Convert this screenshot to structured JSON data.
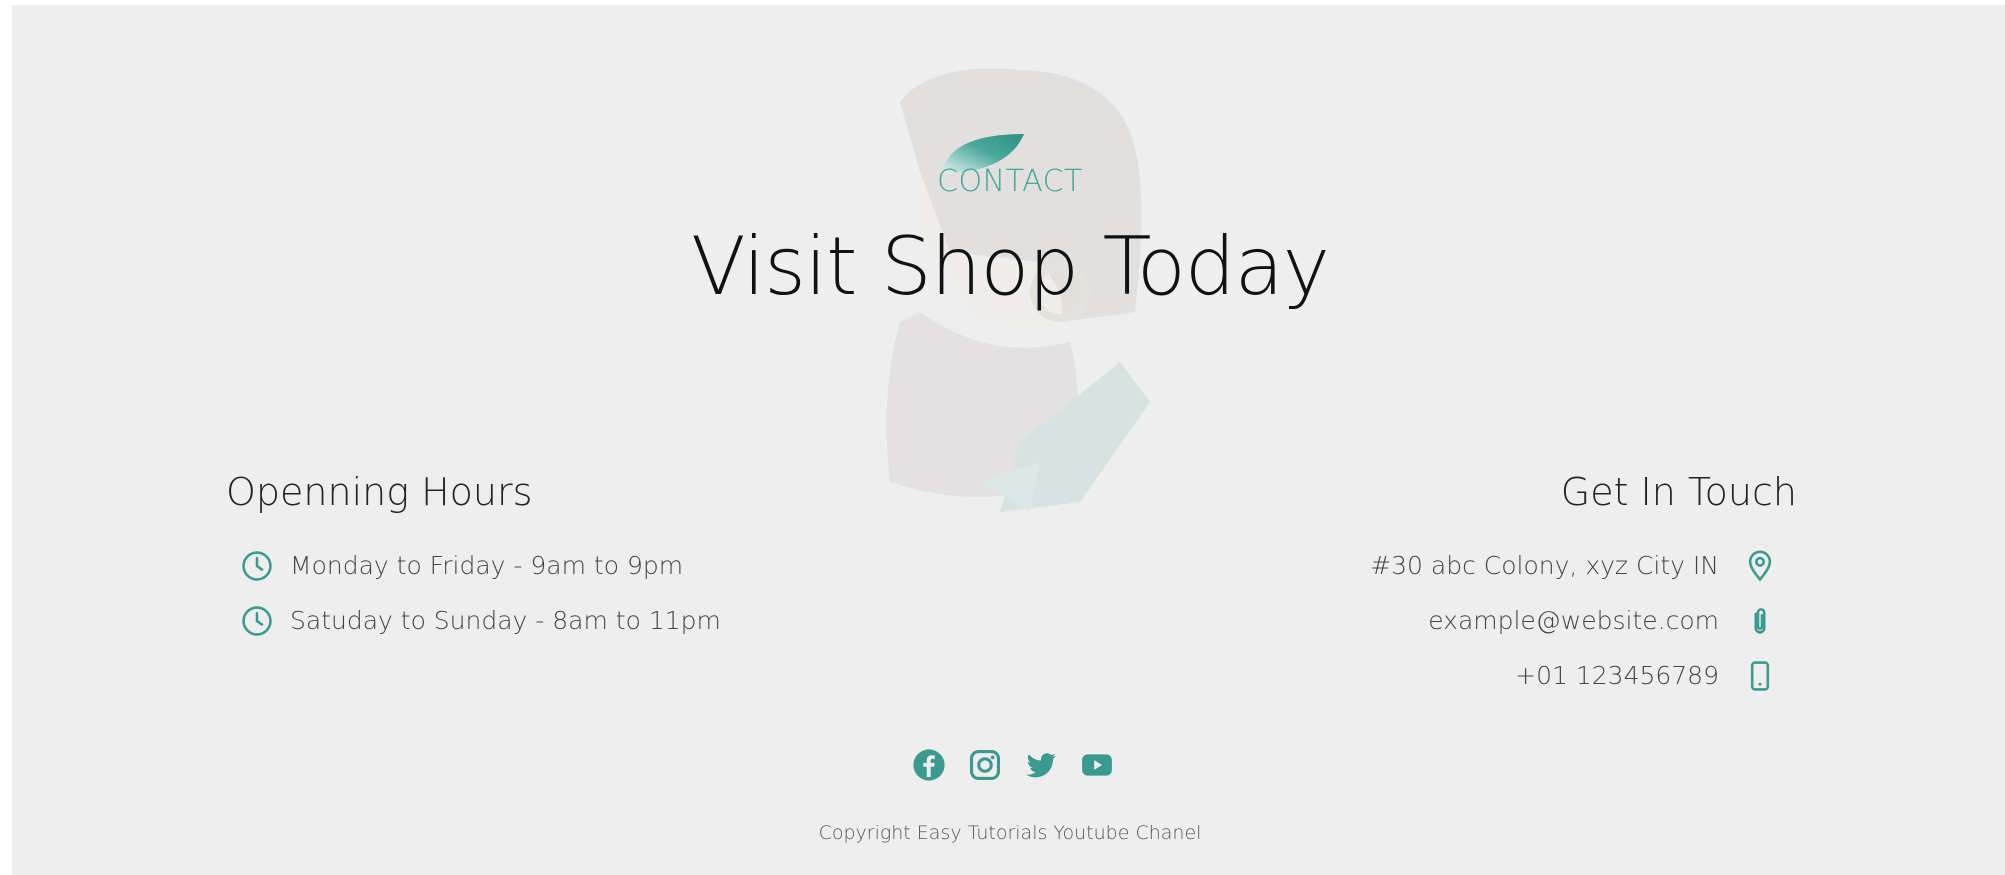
{
  "header": {
    "eyebrow": "CONTACT",
    "title": "Visit Shop Today"
  },
  "hours": {
    "title": "Openning Hours",
    "items": [
      {
        "icon": "clock-icon",
        "text": "Monday to Friday - 9am to 9pm"
      },
      {
        "icon": "clock-icon",
        "text": "Satuday to Sunday - 8am to 11pm"
      }
    ]
  },
  "contact": {
    "title": "Get In Touch",
    "items": [
      {
        "icon": "map-pin-icon",
        "text": "#30 abc Colony, xyz City IN"
      },
      {
        "icon": "paperclip-icon",
        "text": "example@website.com"
      },
      {
        "icon": "phone-icon",
        "text": "+01 123456789"
      }
    ]
  },
  "social": {
    "icons": [
      "facebook-icon",
      "instagram-icon",
      "twitter-icon",
      "youtube-icon"
    ]
  },
  "footer": {
    "copyright": "Copyright Easy Tutorials Youtube Chanel"
  },
  "colors": {
    "accent": "#3a9a8f",
    "background": "#eeeeee",
    "text": "#444444"
  }
}
